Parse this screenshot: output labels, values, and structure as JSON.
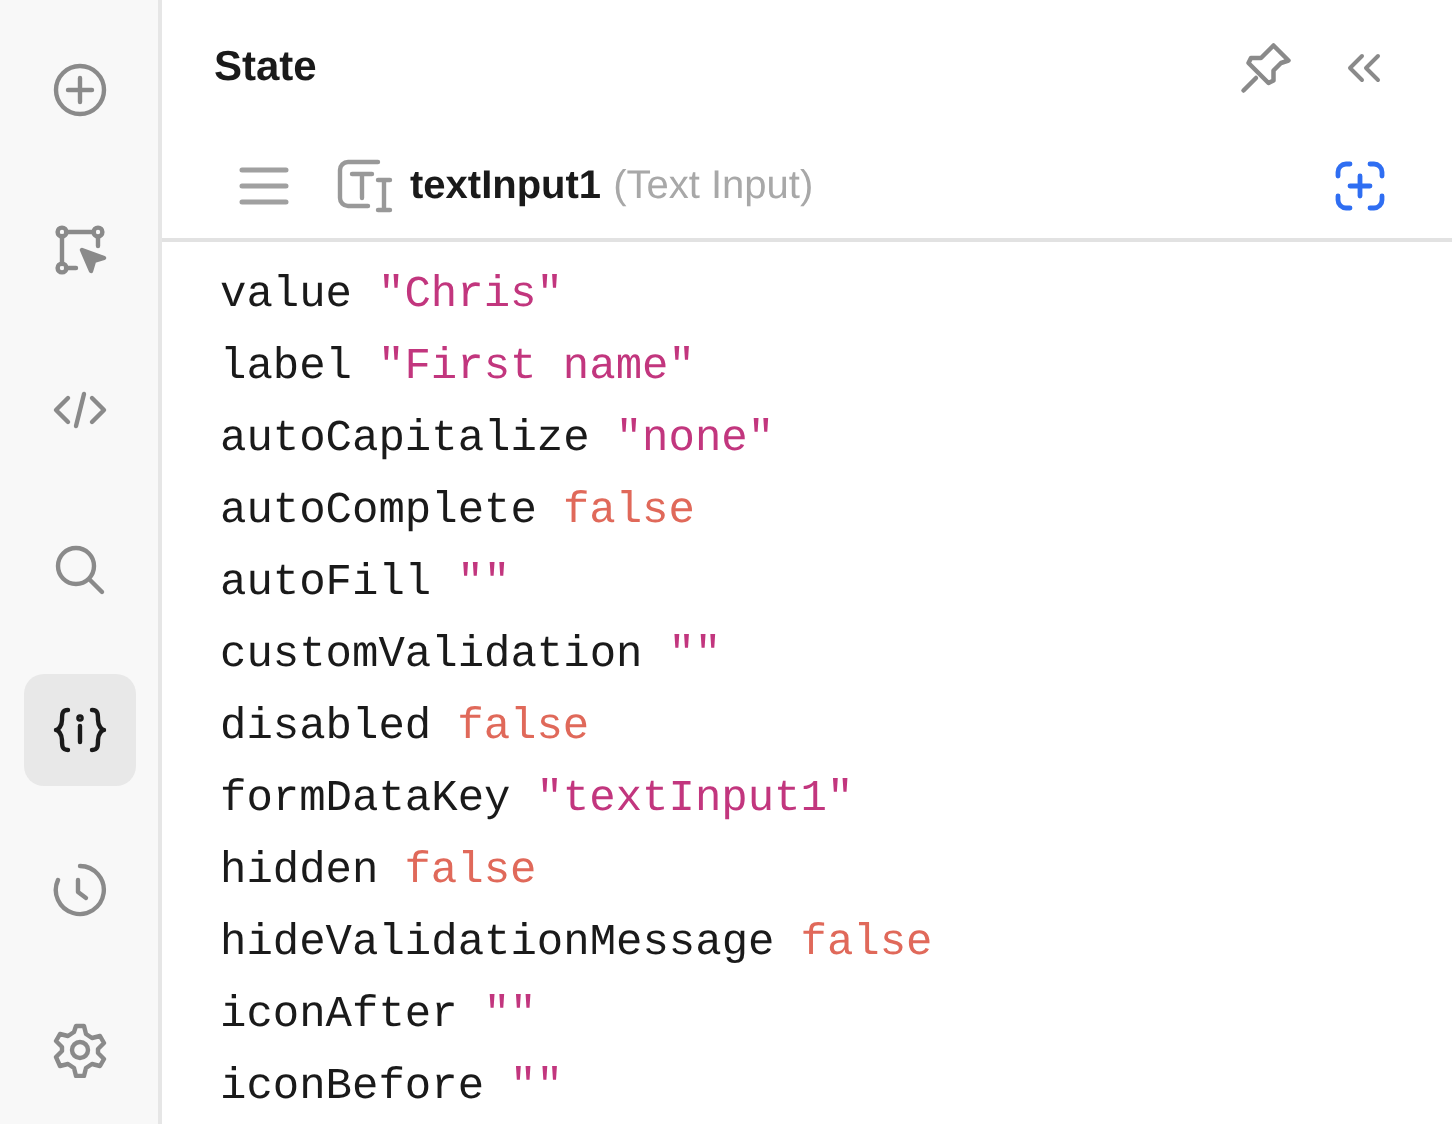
{
  "sidebar": {
    "items": [
      {
        "kind": "plus",
        "selected": false
      },
      {
        "kind": "select",
        "selected": false
      },
      {
        "kind": "code",
        "selected": false
      },
      {
        "kind": "search",
        "selected": false
      },
      {
        "kind": "state",
        "selected": true
      },
      {
        "kind": "history",
        "selected": false
      },
      {
        "kind": "settings",
        "selected": false
      }
    ]
  },
  "panel": {
    "title": "State",
    "component": {
      "name": "textInput1",
      "type": "(Text Input)"
    },
    "properties": [
      {
        "key": "value",
        "value": "\"Chris\"",
        "kind": "string"
      },
      {
        "key": "label",
        "value": "\"First name\"",
        "kind": "string"
      },
      {
        "key": "autoCapitalize",
        "value": "\"none\"",
        "kind": "string"
      },
      {
        "key": "autoComplete",
        "value": "false",
        "kind": "boolean"
      },
      {
        "key": "autoFill",
        "value": "\"\"",
        "kind": "string"
      },
      {
        "key": "customValidation",
        "value": "\"\"",
        "kind": "string"
      },
      {
        "key": "disabled",
        "value": "false",
        "kind": "boolean"
      },
      {
        "key": "formDataKey",
        "value": "\"textInput1\"",
        "kind": "string"
      },
      {
        "key": "hidden",
        "value": "false",
        "kind": "boolean"
      },
      {
        "key": "hideValidationMessage",
        "value": "false",
        "kind": "boolean"
      },
      {
        "key": "iconAfter",
        "value": "\"\"",
        "kind": "string"
      },
      {
        "key": "iconBefore",
        "value": "\"\"",
        "kind": "string"
      }
    ]
  }
}
